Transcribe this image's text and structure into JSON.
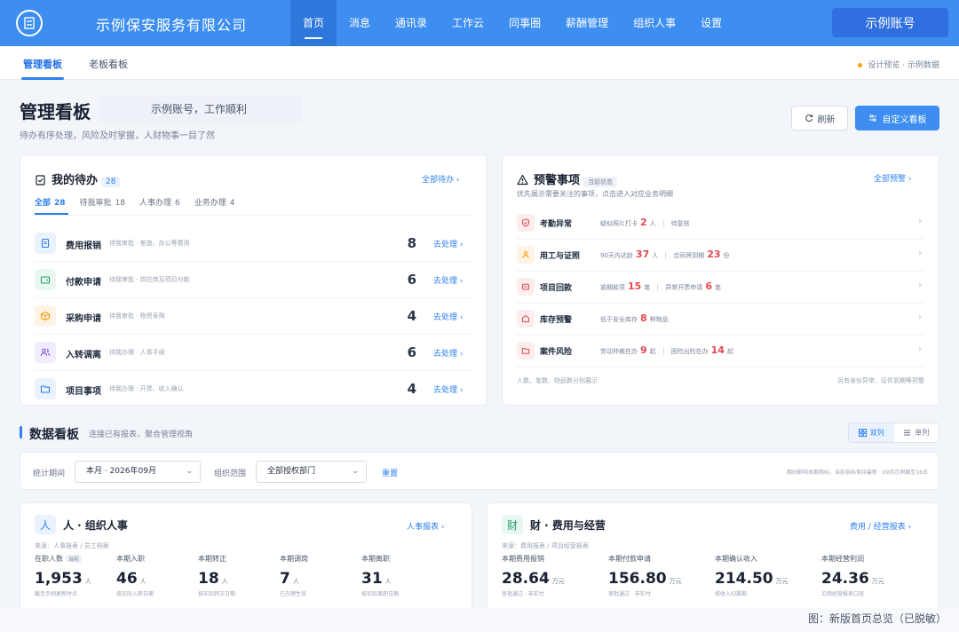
{
  "header": {
    "company": "示例保安服务有限公司",
    "nav": [
      {
        "label": "首页",
        "active": true
      },
      {
        "label": "消息",
        "active": false
      },
      {
        "label": "通讯录",
        "active": false
      },
      {
        "label": "工作云",
        "active": false
      },
      {
        "label": "同事圈",
        "active": false
      },
      {
        "label": "薪酬管理",
        "active": false
      },
      {
        "label": "组织人事",
        "active": false
      },
      {
        "label": "设置",
        "active": false
      }
    ],
    "account": "示例账号"
  },
  "subnav": {
    "tabs": [
      "管理看板",
      "老板看板"
    ],
    "preview": "设计预览 · 示例数据"
  },
  "page": {
    "title": "管理看板",
    "greeting": "示例账号，工作顺利",
    "subtitle": "待办有序处理，风险及时掌握，人财物事一目了然",
    "refresh": "刷新",
    "customize": "自定义看板"
  },
  "todo": {
    "title": "我的待办",
    "count": "28",
    "all_link": "全部待办",
    "tabs": [
      {
        "label": "全部",
        "count": "28"
      },
      {
        "label": "待我审批",
        "count": "18"
      },
      {
        "label": "人事办理",
        "count": "6"
      },
      {
        "label": "业务办理",
        "count": "4"
      }
    ],
    "go_label": "去处理",
    "rows": [
      {
        "name": "费用报销",
        "desc": "待我审批 · 差旅、办公等费用",
        "count": "8",
        "icon": "receipt-icon",
        "bg": "#eaf2fe",
        "fg": "#2f80ed"
      },
      {
        "name": "付款申请",
        "desc": "待我审批 · 供应商及项目付款",
        "count": "6",
        "icon": "wallet-icon",
        "bg": "#e8f7ef",
        "fg": "#22a06b"
      },
      {
        "name": "采购申请",
        "desc": "待我审批 · 物资采购",
        "count": "4",
        "icon": "box-icon",
        "bg": "#fff3e5",
        "fg": "#f59e0b"
      },
      {
        "name": "入转调离",
        "desc": "待我办理 · 人事手续",
        "count": "6",
        "icon": "users-icon",
        "bg": "#f1ecfd",
        "fg": "#7c5cd6"
      },
      {
        "name": "项目事项",
        "desc": "待我办理 · 开票、收入确认",
        "count": "4",
        "icon": "folder-icon",
        "bg": "#eaf2fe",
        "fg": "#2f80ed"
      }
    ]
  },
  "warning": {
    "title": "预警事项",
    "badge": "当前状态",
    "all_link": "全部预警",
    "subtitle": "优先展示需要关注的事项，点击进入对应业务明细",
    "rows": [
      {
        "name": "考勤异常",
        "details": [
          {
            "pre": "疑似照片打卡",
            "num": "2",
            "unit": "人"
          },
          {
            "pre": "待复核",
            "num": "",
            "unit": ""
          }
        ]
      },
      {
        "name": "用工与证照",
        "details": [
          {
            "pre": "90天内达龄",
            "num": "37",
            "unit": "人"
          },
          {
            "pre": "合同将到期",
            "num": "23",
            "unit": "份"
          }
        ]
      },
      {
        "name": "项目回款",
        "details": [
          {
            "pre": "逾期款项",
            "num": "15",
            "unit": "笔"
          },
          {
            "pre": "异常开票申请",
            "num": "6",
            "unit": "笔"
          }
        ]
      },
      {
        "name": "库存预警",
        "details": [
          {
            "pre": "低于安全库存",
            "num": "8",
            "unit": "种物品"
          }
        ]
      },
      {
        "name": "案件风险",
        "details": [
          {
            "pre": "劳动仲裁在办",
            "num": "9",
            "unit": "起"
          },
          {
            "pre": "困险出险在办",
            "num": "14",
            "unit": "起"
          }
        ]
      }
    ],
    "foot_left": "人数、笔数、物品数分别展示",
    "foot_right": "另有身份异常、证件到期等预警"
  },
  "data_board": {
    "title": "数据看板",
    "subtitle": "连接已有报表，聚合管理视角",
    "toggle": [
      "双列",
      "单列"
    ],
    "period_label": "统计期间",
    "period_value": "本月 · 2026年09月",
    "scope_label": "组织范围",
    "scope_value": "全部授权部门",
    "reset": "重置",
    "note": "期间影响本期指标，当前指标保持最新 · 09月示例截至16日"
  },
  "people": {
    "icon_char": "人",
    "title": "人 · 组织人事",
    "link": "人事报表",
    "source": "来源：人事报表 / 员工档案",
    "metrics": [
      {
        "label": "在职人数",
        "tag": "当前",
        "value": "1,953",
        "unit": "人",
        "note": "截至示例更新时点"
      },
      {
        "label": "本期入职",
        "tag": "",
        "value": "46",
        "unit": "人",
        "note": "按实际入职日期"
      },
      {
        "label": "本期转正",
        "tag": "",
        "value": "18",
        "unit": "人",
        "note": "按实际转正日期"
      },
      {
        "label": "本期调岗",
        "tag": "",
        "value": "7",
        "unit": "人",
        "note": "已办理生效"
      },
      {
        "label": "本期离职",
        "tag": "",
        "value": "31",
        "unit": "人",
        "note": "按实际离职日期"
      }
    ]
  },
  "finance": {
    "icon_char": "财",
    "title": "财 · 费用与经营",
    "link": "费用 / 经营报表",
    "source": "来源：费用报表 / 项目经营报表",
    "metrics": [
      {
        "label": "本期费用报销",
        "tag": "",
        "value": "28.64",
        "unit": "万元",
        "note": "审批通过 · 非实付"
      },
      {
        "label": "本期付款申请",
        "tag": "",
        "value": "156.80",
        "unit": "万元",
        "note": "审批通过 · 非实付"
      },
      {
        "label": "本期确认收入",
        "tag": "",
        "value": "214.50",
        "unit": "万元",
        "note": "按收入归属期"
      },
      {
        "label": "本期经营利润",
        "tag": "",
        "value": "24.36",
        "unit": "万元",
        "note": "沿用经营报表口径"
      }
    ]
  },
  "caption": "图：新版首页总览（已脱敏）"
}
